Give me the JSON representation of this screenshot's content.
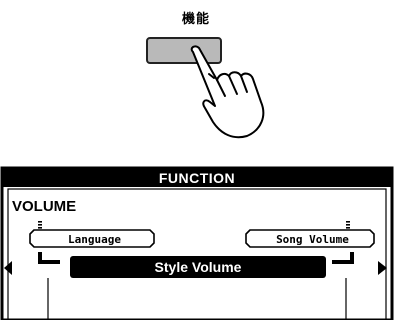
{
  "button": {
    "label": "機能"
  },
  "display": {
    "title": "FUNCTION",
    "category": "VOLUME",
    "items": {
      "left": "Language",
      "right": "Song Volume",
      "selected": "Style Volume"
    }
  }
}
